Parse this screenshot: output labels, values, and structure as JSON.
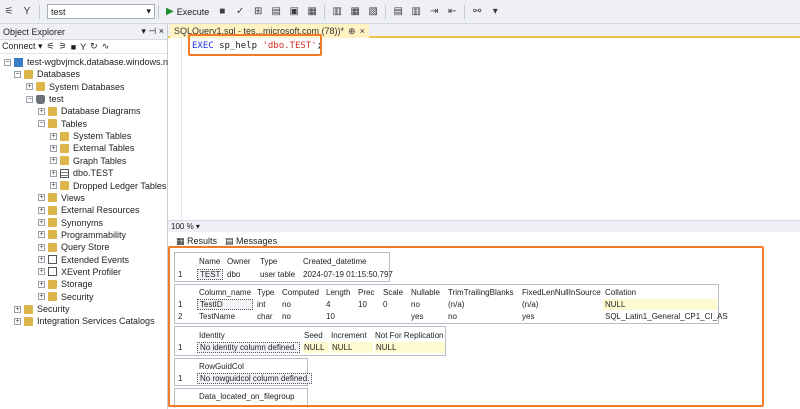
{
  "toolbar": {
    "db_selector": "test",
    "execute_label": "Execute"
  },
  "object_explorer": {
    "title": "Object Explorer",
    "connect_label": "Connect",
    "nodes": [
      {
        "label": "test-wgbvjmck.database.windows.net (",
        "icon": "server-icon",
        "exp": "−"
      },
      {
        "label": "Databases",
        "icon": "folder-icon",
        "exp": "−"
      },
      {
        "label": "System Databases",
        "icon": "folder-icon",
        "exp": "+"
      },
      {
        "label": "test",
        "icon": "database-icon",
        "exp": "−"
      },
      {
        "label": "Database Diagrams",
        "icon": "folder-icon",
        "exp": "+"
      },
      {
        "label": "Tables",
        "icon": "folder-icon",
        "exp": "−"
      },
      {
        "label": "System Tables",
        "icon": "folder-icon",
        "exp": "+"
      },
      {
        "label": "External Tables",
        "icon": "folder-icon",
        "exp": "+"
      },
      {
        "label": "Graph Tables",
        "icon": "folder-icon",
        "exp": "+"
      },
      {
        "label": "dbo.TEST",
        "icon": "table-icon",
        "exp": "+"
      },
      {
        "label": "Dropped Ledger Tables",
        "icon": "folder-icon",
        "exp": "+"
      },
      {
        "label": "Views",
        "icon": "folder-icon",
        "exp": "+"
      },
      {
        "label": "External Resources",
        "icon": "folder-icon",
        "exp": "+"
      },
      {
        "label": "Synonyms",
        "icon": "folder-icon",
        "exp": "+"
      },
      {
        "label": "Programmability",
        "icon": "folder-icon",
        "exp": "+"
      },
      {
        "label": "Query Store",
        "icon": "folder-icon",
        "exp": "+"
      },
      {
        "label": "Extended Events",
        "icon": "xevent-icon",
        "exp": "+"
      },
      {
        "label": "XEvent Profiler",
        "icon": "xevent-icon",
        "exp": "+"
      },
      {
        "label": "Storage",
        "icon": "folder-icon",
        "exp": "+"
      },
      {
        "label": "Security",
        "icon": "folder-icon",
        "exp": "+"
      },
      {
        "label": "Security",
        "icon": "folder-icon",
        "exp": "+"
      },
      {
        "label": "Integration Services Catalogs",
        "icon": "folder-icon",
        "exp": "+"
      }
    ]
  },
  "query_tab": {
    "label": "SQLQuery1.sql - tes...microsoft.com (78))*",
    "pin": "⊕",
    "close": "×"
  },
  "editor": {
    "exec_kw": "EXEC",
    "proc": "sp_help",
    "arg": "'dbo.TEST'",
    "end": ";"
  },
  "zoom": "100 %",
  "result_tabs": {
    "results": "Results",
    "messages": "Messages"
  },
  "grid1": {
    "headers": [
      "Name",
      "Owner",
      "Type",
      "Created_datetime"
    ],
    "row": [
      "1",
      "TEST",
      "dbo",
      "user table",
      "2024-07-19 01:15:50.797"
    ]
  },
  "grid2": {
    "headers": [
      "Column_name",
      "Type",
      "Computed",
      "Length",
      "Prec",
      "Scale",
      "Nullable",
      "TrimTrailingBlanks",
      "FixedLenNullInSource",
      "Collation"
    ],
    "rows": [
      [
        "1",
        "TestID",
        "int",
        "no",
        "4",
        "10",
        "0",
        "no",
        "(n/a)",
        "(n/a)",
        "NULL"
      ],
      [
        "2",
        "TestName",
        "char",
        "no",
        "10",
        "",
        "",
        "yes",
        "no",
        "yes",
        "SQL_Latin1_General_CP1_CI_AS"
      ]
    ]
  },
  "grid3": {
    "headers": [
      "Identity",
      "Seed",
      "Increment",
      "Not For Replication"
    ],
    "row": [
      "1",
      "No identity column defined.",
      "NULL",
      "NULL",
      "NULL"
    ]
  },
  "grid4": {
    "header": "RowGuidCol",
    "row": [
      "1",
      "No rowguidcol column defined."
    ]
  },
  "grid5": {
    "header": "Data_located_on_filegroup"
  },
  "colors": {
    "highlight_box": "#f27a28",
    "keyword": "#1f32e8",
    "string": "#d12b1f"
  }
}
